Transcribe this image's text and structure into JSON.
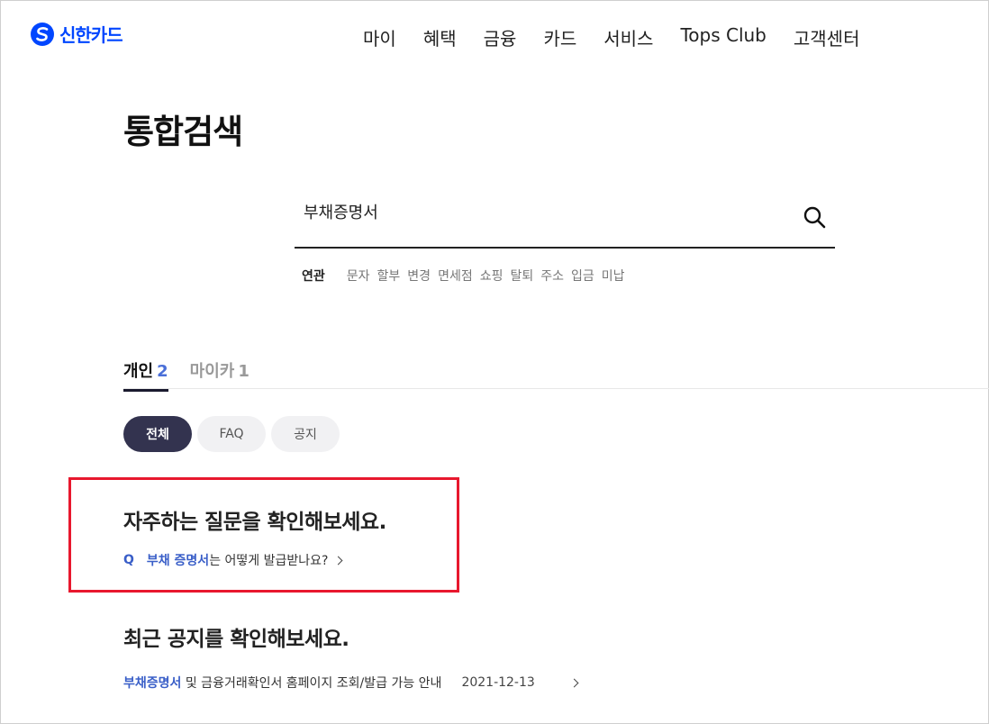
{
  "header": {
    "logo_text": "신한카드",
    "brand_color": "#0046ff",
    "nav": [
      "마이",
      "혜택",
      "금융",
      "카드",
      "서비스",
      "Tops Club",
      "고객센터"
    ]
  },
  "page_title": "통합검색",
  "search": {
    "value": "부채증명서"
  },
  "related": {
    "label": "연관",
    "items": [
      "문자",
      "할부",
      "변경",
      "면세점",
      "쇼핑",
      "탈퇴",
      "주소",
      "입금",
      "미납"
    ]
  },
  "tabs": [
    {
      "label": "개인",
      "count": "2",
      "active": true
    },
    {
      "label": "마이카",
      "count": "1",
      "active": false
    }
  ],
  "filters": [
    {
      "label": "전체",
      "active": true
    },
    {
      "label": "FAQ",
      "active": false
    },
    {
      "label": "공지",
      "active": false
    }
  ],
  "faq": {
    "title": "자주하는 질문을 확인해보세요.",
    "q_mark": "Q",
    "keyword": "부채 증명서",
    "rest": "는 어떻게 발급받나요?"
  },
  "notice": {
    "title": "최근 공지를 확인해보세요.",
    "keyword": "부채증명서",
    "rest": " 및 금융거래확인서 홈페이지 조회/발급 가능 안내",
    "date": "2021-12-13"
  },
  "colors": {
    "accent": "#3a5fc8",
    "chip_active": "#33334f",
    "highlight_border": "#e8182e"
  }
}
